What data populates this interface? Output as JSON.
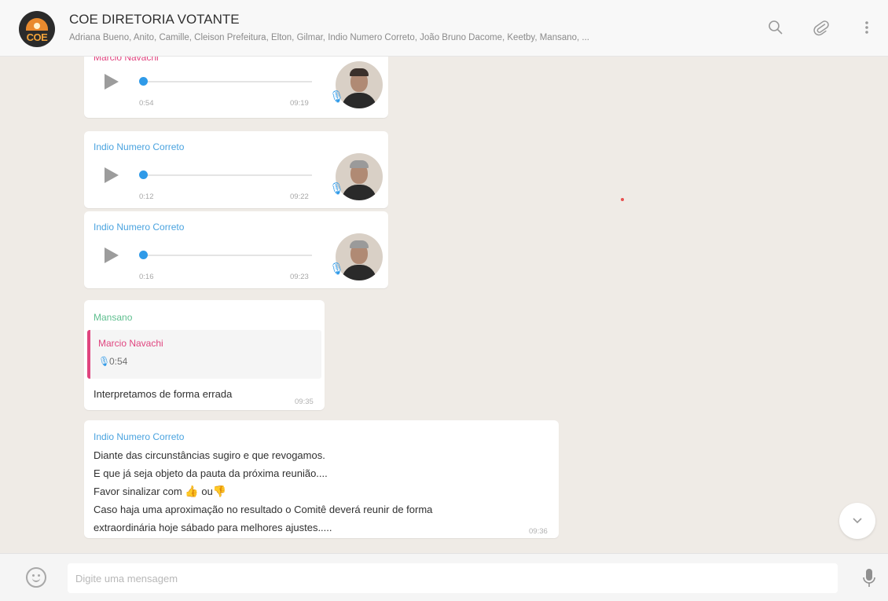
{
  "header": {
    "avatar_text": "COE",
    "title": "COE DIRETORIA VOTANTE",
    "members": "Adriana Bueno, Anito, Camille, Cleison Prefeitura, Elton, Gilmar, Indio Numero Correto, João Bruno Dacome, Keetby, Mansano, ...",
    "icons": [
      "search-icon",
      "attach-icon",
      "menu-icon"
    ]
  },
  "colors": {
    "header_bg": "#f8f8f8",
    "chat_bg": "#efebe6",
    "bubble_bg": "#ffffff",
    "sender_blue": "#4aa3df",
    "sender_pink": "#e0457f",
    "sender_green": "#5fbf8f",
    "accent_blue": "#2f9ae8"
  },
  "messages": [
    {
      "sender": "Marcio Navachi",
      "type": "voice",
      "duration": "0:54",
      "time": "09:19"
    },
    {
      "sender": "Indio Numero Correto",
      "type": "voice",
      "duration": "0:12",
      "time": "09:22"
    },
    {
      "sender": "Indio Numero Correto",
      "type": "voice",
      "duration": "0:16",
      "time": "09:23"
    },
    {
      "sender": "Mansano",
      "type": "reply",
      "quote_sender": "Marcio Navachi",
      "quote_duration": "0:54",
      "text": "Interpretamos de forma errada",
      "time": "09:35"
    },
    {
      "sender": "Indio Numero Correto",
      "type": "text",
      "lines": [
        "Diante das circunstâncias  sugiro e que revogamos.",
        "E que já seja objeto da pauta da próxima reunião....",
        "Favor sinalizar  com ",
        " ou",
        "Caso haja uma aproximação  no resultado o Comitê deverá reunir de forma",
        "extraordinária hoje sábado para melhores ajustes....."
      ],
      "time": "09:36"
    }
  ],
  "composer": {
    "placeholder": "Digite uma mensagem",
    "icons": [
      "emoji-icon",
      "mic-icon"
    ]
  }
}
